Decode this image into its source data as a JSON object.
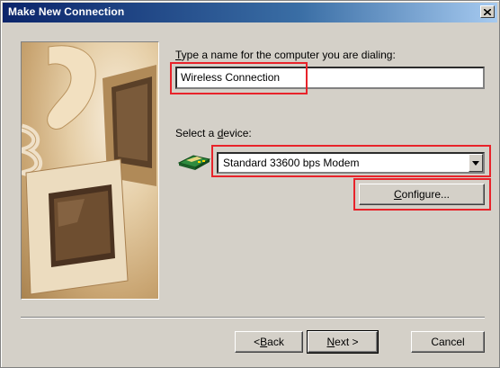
{
  "window": {
    "title": "Make New Connection"
  },
  "name_prompt": {
    "ul": "T",
    "rest": "ype a name for the computer you are dialing:"
  },
  "connection_name": "Wireless Connection",
  "device_prompt": {
    "pre": "Select a ",
    "ul": "d",
    "rest": "evice:"
  },
  "device": {
    "selected": "Standard 33600 bps Modem"
  },
  "buttons": {
    "configure": {
      "ul": "C",
      "rest": "onfigure..."
    },
    "back": {
      "pre": "< ",
      "ul": "B",
      "rest": "ack"
    },
    "next": {
      "ul": "N",
      "rest": "ext >"
    },
    "cancel": "Cancel"
  },
  "icons": {
    "close": "close-icon",
    "modem": "modem-icon",
    "dropdown": "chevron-down-icon",
    "illustration": "computer-phone-illustration"
  },
  "colors": {
    "title_bar_start": "#0a246a",
    "title_bar_end": "#a6caf0",
    "dialog_face": "#d4d0c8",
    "highlight": "#e8232a"
  }
}
